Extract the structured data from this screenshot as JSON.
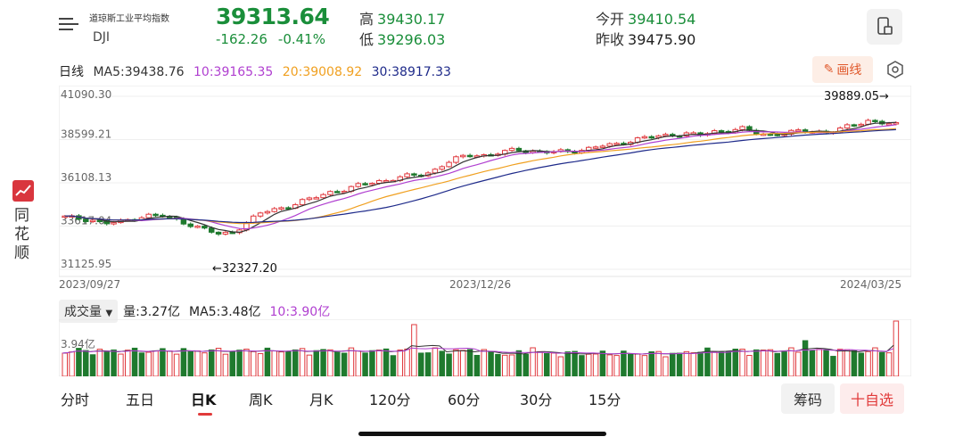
{
  "header": {
    "name_cn": "道琼斯工业平均指数",
    "code": "DJI",
    "price": "39313.64",
    "change": "-162.26",
    "change_pct": "-0.41%",
    "high_label": "高",
    "high": "39430.17",
    "low_label": "低",
    "low": "39296.03",
    "open_label": "今开",
    "open": "39410.54",
    "prev_close_label": "昨收",
    "prev_close": "39475.90"
  },
  "ma_bar": {
    "period": "日线",
    "ma5": "MA5:39438.76",
    "ma10": "10:39165.35",
    "ma20": "20:39008.92",
    "ma30": "30:38917.33",
    "draw_label": "画线"
  },
  "side": {
    "logo_text": "同花顺"
  },
  "chart": {
    "y_ticks": [
      "41090.30",
      "38599.21",
      "36108.13",
      "33617.04",
      "31125.95"
    ],
    "x_labels": [
      "2023/09/27",
      "2023/12/26",
      "2024/03/25"
    ],
    "max_annotation": "39889.05→",
    "min_annotation": "←32327.20"
  },
  "volume": {
    "selector": "成交量",
    "vol": "量:3.27亿",
    "ma5": "MA5:3.48亿",
    "ma10": "10:3.90亿",
    "y_tick": "3.94亿"
  },
  "tabs": [
    "分时",
    "五日",
    "日K",
    "周K",
    "月K",
    "120分",
    "60分",
    "30分",
    "15分"
  ],
  "active_tab": "日K",
  "buttons": {
    "chips": "筹码",
    "watchlist": "十自选"
  },
  "colors": {
    "up": "#e0393e",
    "down": "#1f7a2e",
    "ma5": "#333333",
    "ma10": "#b03fd0",
    "ma20": "#f0a020",
    "ma30": "#1e2a8a"
  },
  "chart_data": {
    "type": "candlestick",
    "x_range": [
      "2023/09/27",
      "2024/03/25"
    ],
    "ylim": [
      31125.95,
      41090.3
    ],
    "max_price": 39889.05,
    "min_price": 32327.2,
    "close_trend": [
      33600,
      33500,
      33400,
      33200,
      33300,
      33550,
      33700,
      33650,
      33400,
      33100,
      32800,
      32500,
      32700,
      33300,
      33900,
      34100,
      34300,
      34600,
      34900,
      35200,
      35300,
      35600,
      35800,
      35900,
      36100,
      36200,
      36400,
      36900,
      37300,
      37500,
      37400,
      37600,
      37800,
      37700,
      37600,
      37650,
      37700,
      37800,
      38000,
      38100,
      38300,
      38500,
      38600,
      38700,
      38800,
      38650,
      38900,
      38950,
      39100,
      38800,
      38700,
      38800,
      38900,
      38950,
      38850,
      39050,
      39300,
      39600,
      39450,
      39313
    ]
  }
}
